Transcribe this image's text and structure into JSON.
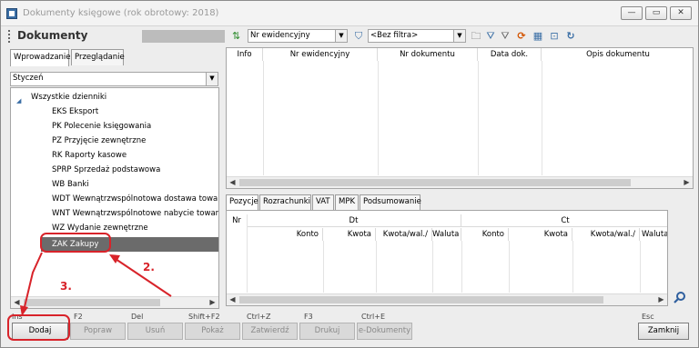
{
  "window": {
    "title": "Dokumenty księgowe (rok obrotowy: 2018)",
    "min_glyph": "—",
    "max_glyph": "▭",
    "close_glyph": "✕"
  },
  "left_panel": {
    "title": "Dokumenty",
    "tabs": [
      "Wprowadzanie",
      "Przeglądanie"
    ],
    "month": "Styczeń",
    "tree": {
      "root": "Wszystkie dzienniki",
      "items": [
        "EKS Eksport",
        "PK Polecenie księgowania",
        "PZ Przyjęcie zewnętrzne",
        "RK Raporty kasowe",
        "SPRP Sprzedaż podstawowa",
        "WB Banki",
        "WDT Wewnątrzwspólnotowa dostawa towarów",
        "WNT Wewnątrzwspólnotowe nabycie towarów",
        "WZ Wydanie zewnętrzne",
        "ZAK Zakupy"
      ],
      "selected": "ZAK Zakupy"
    }
  },
  "toolbar": {
    "sort_field": "Nr ewidencyjny",
    "filter": "<Bez filtra>",
    "sort_icon_glyph": "⇅",
    "filter_icon_glyph": "⛉",
    "folder_icon_glyph": "🗀",
    "funnel_icon_glyph": "⛛",
    "funnel2_icon_glyph": "⛛",
    "refresh_icon_glyph": "⟳",
    "grid_icon_glyph": "▦",
    "export_icon_glyph": "⊡",
    "reload_icon_glyph": "↻"
  },
  "documents_grid": {
    "columns": [
      "Info",
      "Nr ewidencyjny",
      "Nr dokumentu",
      "Data dok.",
      "Opis dokumentu"
    ]
  },
  "detail_tabs": [
    "Pozycje",
    "Rozrachunki",
    "VAT",
    "MPK",
    "Podsumowanie"
  ],
  "positions_grid": {
    "nr": "Nr",
    "dt": "Dt",
    "ct": "Ct",
    "columns": [
      "Konto",
      "Kwota",
      "Kwota/wal./",
      "Waluta",
      "Konto",
      "Kwota",
      "Kwota/wal./",
      "Waluta"
    ]
  },
  "footer": {
    "buttons": [
      {
        "key": "Ins",
        "label": "Dodaj"
      },
      {
        "key": "F2",
        "label": "Popraw"
      },
      {
        "key": "Del",
        "label": "Usuń"
      },
      {
        "key": "Shift+F2",
        "label": "Pokaż"
      },
      {
        "key": "Ctrl+Z",
        "label": "Zatwierdź"
      },
      {
        "key": "F3",
        "label": "Drukuj"
      },
      {
        "key": "Ctrl+E",
        "label": "e-Dokumenty"
      }
    ],
    "close": {
      "key": "Esc",
      "label": "Zamknij"
    }
  },
  "annotations": {
    "step2": "2.",
    "step3": "3.",
    "color": "#d8232a"
  },
  "colors": {
    "accent": "#d8232a",
    "selection": "#6b6b6b",
    "tree_caret": "#3a6ea5"
  }
}
